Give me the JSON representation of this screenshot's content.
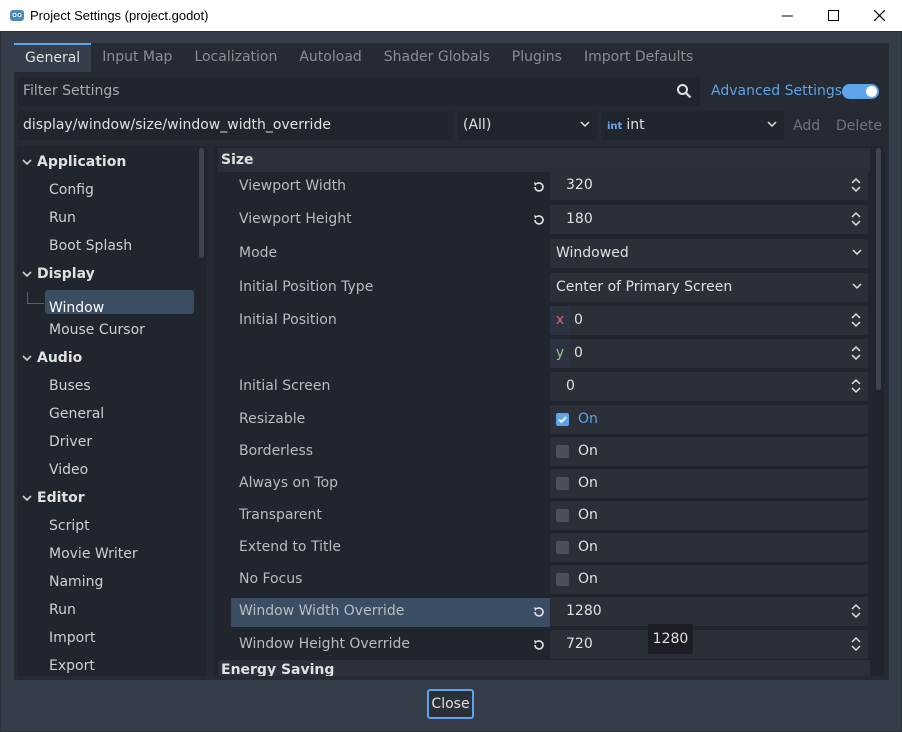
{
  "window": {
    "title": "Project Settings (project.godot)"
  },
  "tabs": [
    "General",
    "Input Map",
    "Localization",
    "Autoload",
    "Shader Globals",
    "Plugins",
    "Import Defaults"
  ],
  "filter": {
    "placeholder": "Filter Settings",
    "advanced_label": "Advanced Settings",
    "advanced_on": true
  },
  "path": {
    "value": "display/window/size/window_width_override"
  },
  "type_filter": {
    "all": "(All)",
    "type_badge": "int",
    "type": "int",
    "add": "Add",
    "delete": "Delete"
  },
  "tree": [
    {
      "label": "Application",
      "kind": "cat"
    },
    {
      "label": "Config",
      "kind": "sub"
    },
    {
      "label": "Run",
      "kind": "sub"
    },
    {
      "label": "Boot Splash",
      "kind": "sub"
    },
    {
      "label": "Display",
      "kind": "cat"
    },
    {
      "label": "Window",
      "kind": "sub",
      "selected": true
    },
    {
      "label": "Mouse Cursor",
      "kind": "sub"
    },
    {
      "label": "Audio",
      "kind": "cat"
    },
    {
      "label": "Buses",
      "kind": "sub"
    },
    {
      "label": "General",
      "kind": "sub"
    },
    {
      "label": "Driver",
      "kind": "sub"
    },
    {
      "label": "Video",
      "kind": "sub"
    },
    {
      "label": "Editor",
      "kind": "cat"
    },
    {
      "label": "Script",
      "kind": "sub"
    },
    {
      "label": "Movie Writer",
      "kind": "sub"
    },
    {
      "label": "Naming",
      "kind": "sub"
    },
    {
      "label": "Run",
      "kind": "sub"
    },
    {
      "label": "Import",
      "kind": "sub"
    },
    {
      "label": "Export",
      "kind": "sub"
    }
  ],
  "sections": {
    "size": "Size",
    "energy": "Energy Saving"
  },
  "props": {
    "viewport_width": {
      "label": "Viewport Width",
      "value": "320"
    },
    "viewport_height": {
      "label": "Viewport Height",
      "value": "180"
    },
    "mode": {
      "label": "Mode",
      "value": "Windowed"
    },
    "initial_position_type": {
      "label": "Initial Position Type",
      "value": "Center of Primary Screen"
    },
    "initial_position": {
      "label": "Initial Position",
      "x_axis": "x",
      "x": "0",
      "y_axis": "y",
      "y": "0"
    },
    "initial_screen": {
      "label": "Initial Screen",
      "value": "0"
    },
    "resizable": {
      "label": "Resizable",
      "value": "On",
      "checked": true
    },
    "borderless": {
      "label": "Borderless",
      "value": "On",
      "checked": false
    },
    "always_on_top": {
      "label": "Always on Top",
      "value": "On",
      "checked": false
    },
    "transparent": {
      "label": "Transparent",
      "value": "On",
      "checked": false
    },
    "extend_to_title": {
      "label": "Extend to Title",
      "value": "On",
      "checked": false
    },
    "no_focus": {
      "label": "No Focus",
      "value": "On",
      "checked": false
    },
    "window_width_override": {
      "label": "Window Width Override",
      "value": "1280"
    },
    "window_height_override": {
      "label": "Window Height Override",
      "value": "720"
    }
  },
  "tooltip": "1280",
  "close_label": "Close",
  "colors": {
    "accent": "#5fa3e8",
    "panel": "#252a33",
    "selection": "#3b4d63"
  }
}
